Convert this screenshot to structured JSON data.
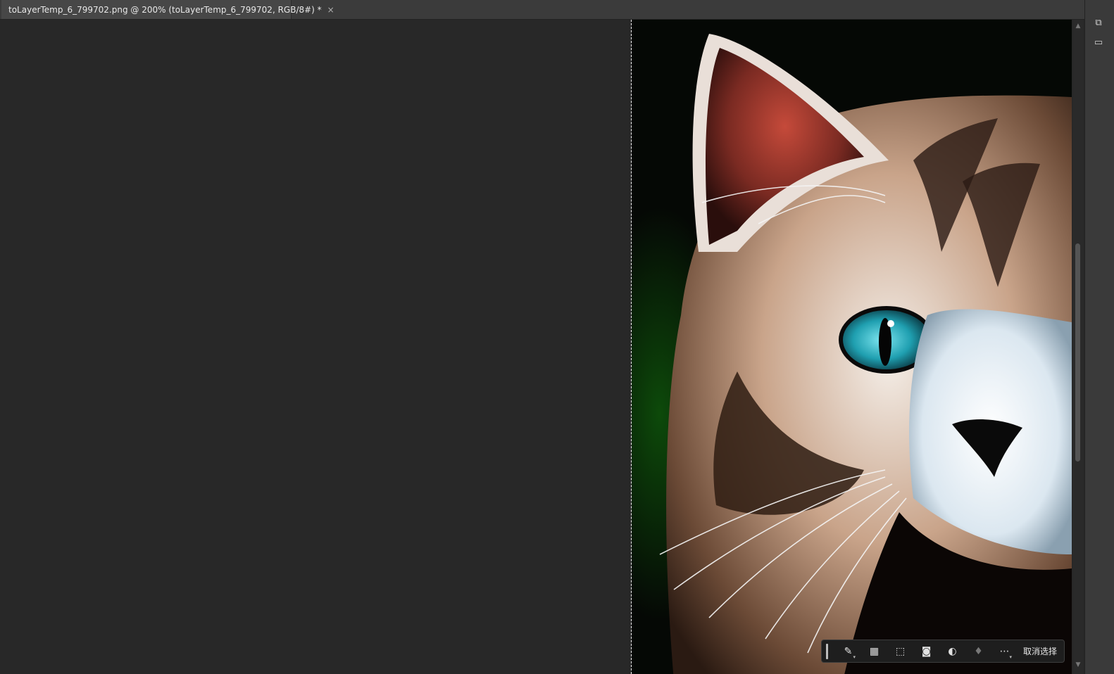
{
  "document": {
    "tab_title": "toLayerTemp_6_799702.png @ 200% (toLayerTemp_6_799702, RGB/8#) *",
    "close_glyph": "×"
  },
  "canvas": {
    "image_subject": "cat-photo"
  },
  "contextual_taskbar": {
    "buttons": [
      {
        "icon": "brush-select-icon"
      },
      {
        "icon": "select-subject-icon"
      },
      {
        "icon": "transform-selection-icon"
      },
      {
        "icon": "mask-icon"
      },
      {
        "icon": "adjustment-icon"
      },
      {
        "icon": "fill-icon"
      },
      {
        "icon": "more-icon"
      }
    ],
    "deselect_label": "取消选择"
  },
  "colors": {
    "workspace": "#282828",
    "tab_active": "#474747",
    "taskbar_bg": "#1e1e1e"
  }
}
